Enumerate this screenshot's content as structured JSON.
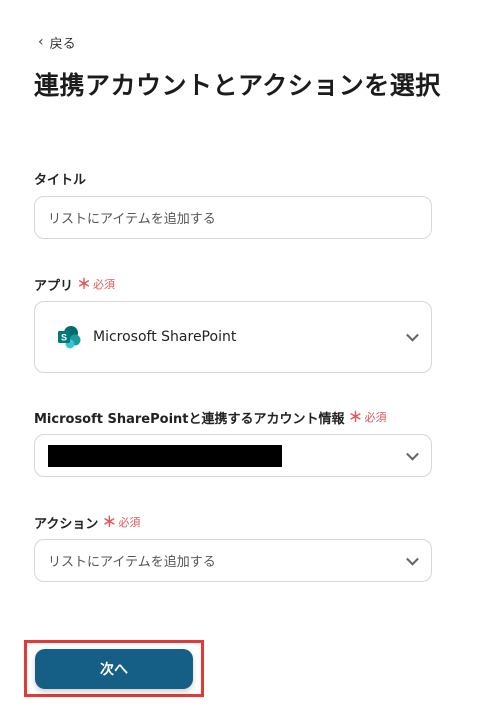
{
  "nav": {
    "back_label": "戻る"
  },
  "page": {
    "title": "連携アカウントとアクションを選択"
  },
  "fields": {
    "title": {
      "label": "タイトル",
      "value": "リストにアイテムを追加する"
    },
    "app": {
      "label": "アプリ",
      "required_mark": "＊",
      "required_text": "必須",
      "value": "Microsoft SharePoint",
      "icon": "sharepoint-icon"
    },
    "account": {
      "label": "Microsoft SharePointと連携するアカウント情報",
      "required_mark": "＊",
      "required_text": "必須",
      "value": "[redacted]"
    },
    "action": {
      "label": "アクション",
      "required_mark": "＊",
      "required_text": "必須",
      "value": "リストにアイテムを追加する"
    }
  },
  "footer": {
    "next_label": "次へ"
  },
  "colors": {
    "primary": "#155f87",
    "required": "#e0585a",
    "highlight": "#e53935"
  }
}
